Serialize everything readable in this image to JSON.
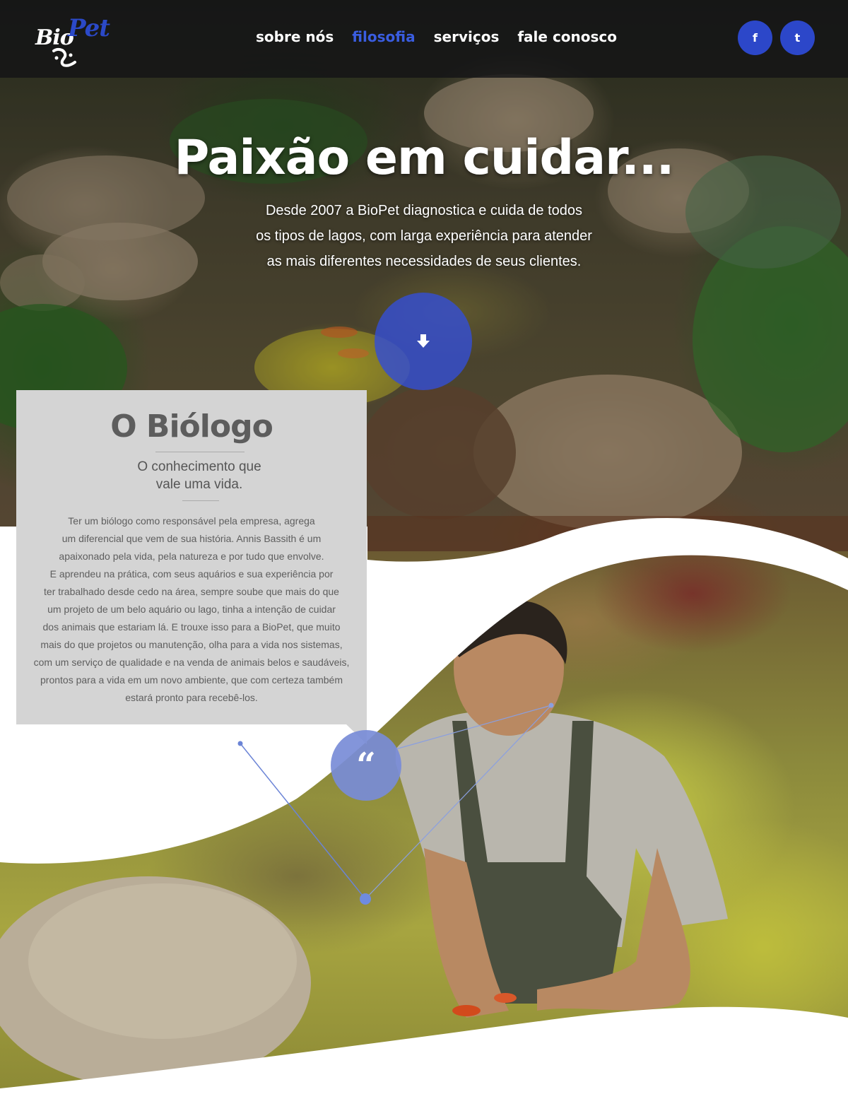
{
  "brand": {
    "logo_part1": "Bio",
    "logo_part2": "Pet",
    "color_primary": "#2c47c9",
    "color_nav_active": "#3a5de0"
  },
  "nav": {
    "items": [
      {
        "label": "sobre nós",
        "active": false
      },
      {
        "label": "filosofia",
        "active": true
      },
      {
        "label": "serviços",
        "active": false
      },
      {
        "label": "fale conosco",
        "active": false
      }
    ]
  },
  "social": {
    "facebook_glyph": "f",
    "twitter_glyph": "t",
    "facebook_icon": "facebook-icon",
    "twitter_icon": "twitter-icon"
  },
  "hero": {
    "title": "Paixão em cuidar...",
    "subtitle_lines": [
      "Desde 2007 a BioPet diagnostica e cuida de todos",
      "os tipos de lagos, com larga experiência para atender",
      "as mais diferentes necessidades de seus clientes."
    ],
    "scroll_icon": "arrow-down-icon"
  },
  "biologist": {
    "title": "O Biólogo",
    "subtitle_lines": [
      "O conhecimento que",
      "vale uma vida."
    ],
    "body_lines": [
      "Ter um biólogo como responsável pela  empresa, agrega",
      "um diferencial que vem de sua história. Annis Bassith é um",
      "apaixonado pela vida, pela natureza e por tudo que envolve.",
      "E aprendeu na prática, com seus aquários e sua experiência por",
      "ter trabalhado desde cedo na área, sempre soube que mais do que",
      "um projeto de um belo aquário ou lago, tinha a intenção de cuidar",
      "dos animais que estariam lá. E trouxe isso para a BioPet, que muito",
      "mais do que projetos ou manutenção, olha para a vida nos sistemas,",
      "com um serviço de qualidade e na venda de animais belos e saudáveis,",
      "prontos para a vida em um novo ambiente, que com certeza também",
      "estará pronto para recebê-los."
    ],
    "quote_glyph": "“",
    "quote_icon": "quote-icon"
  }
}
